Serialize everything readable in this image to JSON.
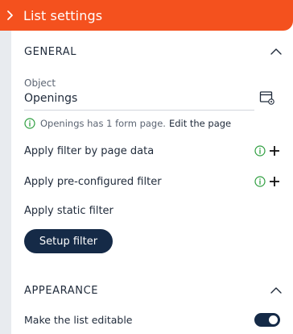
{
  "header": {
    "title": "List settings"
  },
  "general": {
    "section_title": "GENERAL",
    "object_label": "Object",
    "object_value": "Openings",
    "info_text": "Openings has 1 form page.",
    "info_link": "Edit the page",
    "filters": [
      {
        "label": "Apply filter by page data"
      },
      {
        "label": "Apply pre-configured filter"
      }
    ],
    "static_filter_label": "Apply static filter",
    "setup_button": "Setup filter"
  },
  "appearance": {
    "section_title": "APPEARANCE",
    "editable_label": "Make the list editable",
    "editable_on": true
  },
  "colors": {
    "header_bg": "#f4511e",
    "primary_dark": "#152a47",
    "info_green": "#2e9e3f"
  },
  "icons": {
    "header": "chevron-right-icon",
    "collapse": "chevron-up-icon",
    "object_picker": "window-settings-icon",
    "info": "info-circle-icon",
    "add": "plus-icon"
  }
}
